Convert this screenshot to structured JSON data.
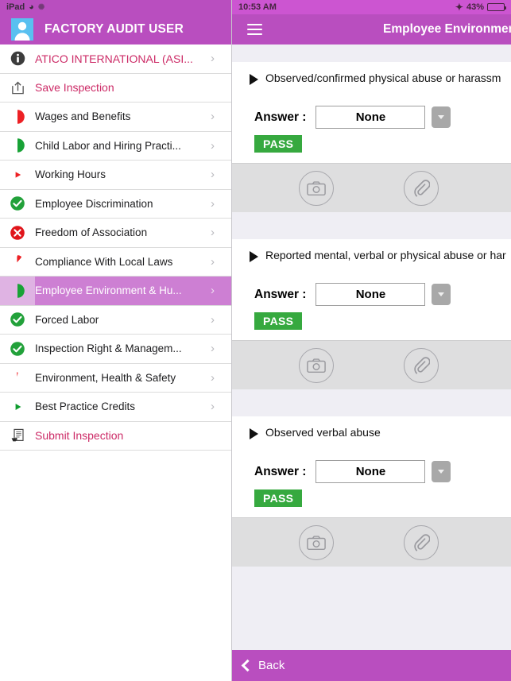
{
  "sidebar": {
    "statusbar": {
      "device": "iPad",
      "wifi_icon": "wifi-icon",
      "sync_icon": "sync-icon"
    },
    "header": {
      "avatar_icon": "user-avatar-icon",
      "title": "FACTORY AUDIT USER"
    },
    "items": [
      {
        "label": "ATICO INTERNATIONAL (ASI...",
        "icon": "info-circle-icon",
        "style": "accent",
        "chevron": "›"
      },
      {
        "label": "Save Inspection",
        "icon": "save-upload-icon",
        "style": "accent",
        "chevron": ""
      },
      {
        "label": "Wages and Benefits",
        "icon": "status-half-red-icon",
        "style": "normal",
        "chevron": "›"
      },
      {
        "label": "Child Labor and Hiring Practi...",
        "icon": "status-half-green-icon",
        "style": "normal",
        "chevron": "›"
      },
      {
        "label": "Working Hours",
        "icon": "status-sliver-red-icon",
        "style": "normal",
        "chevron": "›"
      },
      {
        "label": "Employee Discrimination",
        "icon": "status-check-green-icon",
        "style": "normal",
        "chevron": "›"
      },
      {
        "label": "Freedom of Association",
        "icon": "status-cross-red-icon",
        "style": "normal",
        "chevron": "›"
      },
      {
        "label": "Compliance With Local Laws",
        "icon": "status-wedge-red-icon",
        "style": "normal",
        "chevron": "›"
      },
      {
        "label": "Employee Environment & Hu...",
        "icon": "status-half-green-icon",
        "style": "selected",
        "chevron": "›"
      },
      {
        "label": "Forced Labor",
        "icon": "status-check-green-icon",
        "style": "normal",
        "chevron": "›"
      },
      {
        "label": "Inspection Right & Managem...",
        "icon": "status-check-green-icon",
        "style": "normal",
        "chevron": "›"
      },
      {
        "label": "Environment, Health & Safety",
        "icon": "status-tiny-red-icon",
        "style": "normal",
        "chevron": "›"
      },
      {
        "label": "Best Practice Credits",
        "icon": "status-wedge-green-icon",
        "style": "normal",
        "chevron": "›"
      },
      {
        "label": "Submit Inspection",
        "icon": "submit-document-icon",
        "style": "accent",
        "chevron": ""
      }
    ]
  },
  "main": {
    "statusbar": {
      "time": "10:53 AM",
      "bluetooth_icon": "bluetooth-icon",
      "battery_percent": "43%",
      "battery_level": 43
    },
    "header": {
      "menu_icon": "hamburger-menu-icon",
      "title": "Employee Environment &"
    },
    "questions": [
      {
        "text": "Observed/confirmed physical  abuse or harassm",
        "expander_icon": "triangle-right-icon",
        "answer_label": "Answer  :",
        "answer_value": "None",
        "dropdown_icon": "caret-down-icon",
        "status_badge": "PASS",
        "camera_icon": "camera-icon",
        "attachment_icon": "paperclip-icon"
      },
      {
        "text": "Reported mental, verbal or physical abuse or har",
        "expander_icon": "triangle-right-icon",
        "answer_label": "Answer  :",
        "answer_value": "None",
        "dropdown_icon": "caret-down-icon",
        "status_badge": "PASS",
        "camera_icon": "camera-icon",
        "attachment_icon": "paperclip-icon"
      },
      {
        "text": "Observed verbal abuse",
        "expander_icon": "triangle-right-icon",
        "answer_label": "Answer  :",
        "answer_value": "None",
        "dropdown_icon": "caret-down-icon",
        "status_badge": "PASS",
        "camera_icon": "camera-icon",
        "attachment_icon": "paperclip-icon"
      }
    ],
    "bottom_bar": {
      "back_label": "Back",
      "back_icon": "chevron-left-icon"
    }
  },
  "colors": {
    "brand_purple": "#b94ebf",
    "selected_row": "#cd7fd3",
    "accent_text": "#cc2a66",
    "pass_green": "#36a93f",
    "status_red": "#ed2024",
    "status_green": "#22a13a",
    "panel_bg": "#efeef4"
  }
}
